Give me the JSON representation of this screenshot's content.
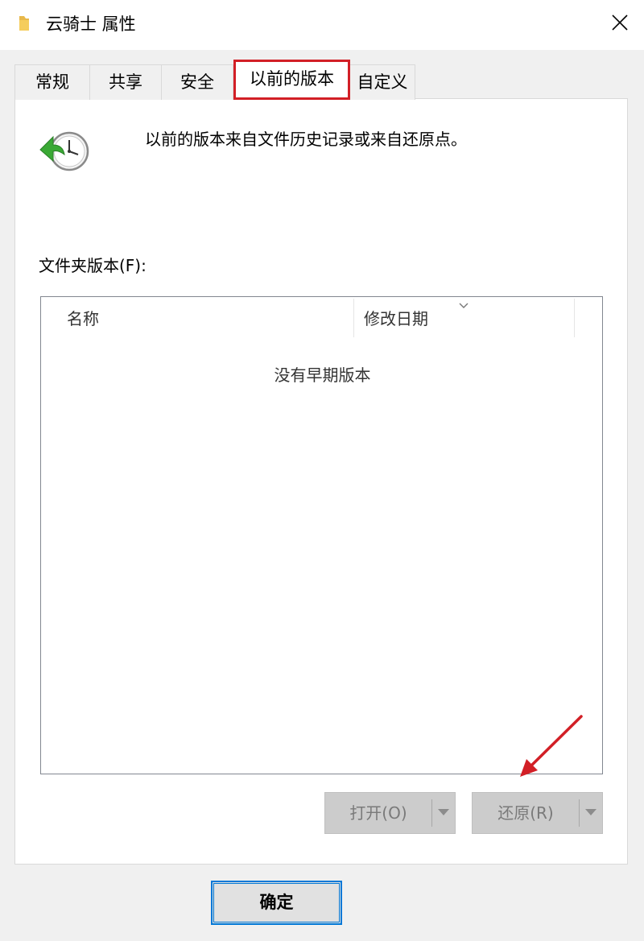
{
  "window": {
    "title": "云骑士 属性",
    "folder_icon": "folder-icon",
    "close_icon": "close-icon"
  },
  "tabs": [
    {
      "label": "常规",
      "active": false
    },
    {
      "label": "共享",
      "active": false
    },
    {
      "label": "安全",
      "active": false
    },
    {
      "label": "以前的版本",
      "active": true
    },
    {
      "label": "自定义",
      "active": false
    }
  ],
  "content": {
    "icon": "restore-clock-icon",
    "description": "以前的版本来自文件历史记录或来自还原点。",
    "folder_versions_label": "文件夹版本(F):",
    "list": {
      "columns": [
        "名称",
        "修改日期"
      ],
      "empty_message": "没有早期版本"
    }
  },
  "buttons": {
    "open_label": "打开(O)",
    "restore_label": "还原(R)",
    "ok_label": "确定"
  },
  "colors": {
    "highlight_border": "#d21f26",
    "annotation_arrow": "#d21f26",
    "focus_border": "#0078d7"
  }
}
